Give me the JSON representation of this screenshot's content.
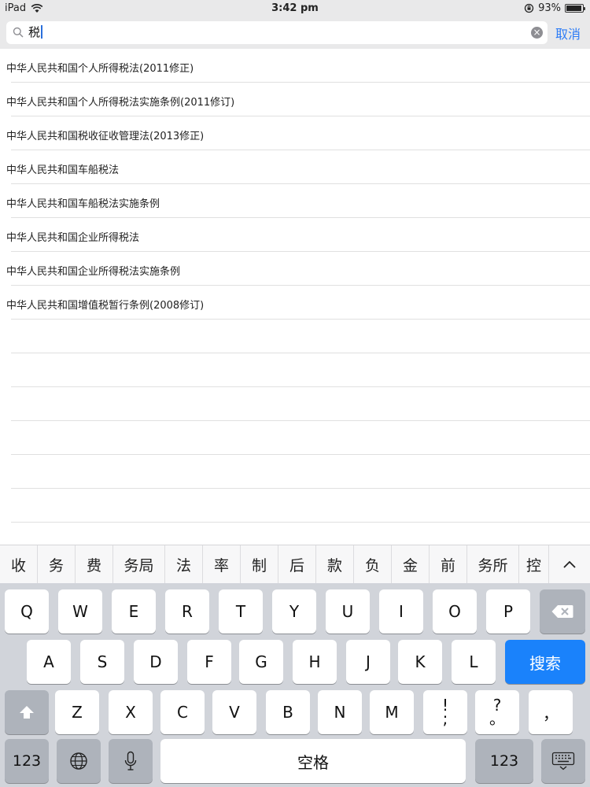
{
  "status": {
    "device": "iPad",
    "time": "3:42 pm",
    "battery": "93%",
    "battery_level": 0.93
  },
  "search": {
    "value": "税",
    "cancel_label": "取消"
  },
  "results": [
    "中华人民共和国个人所得税法(2011修正)",
    "中华人民共和国个人所得税法实施条例(2011修订)",
    "中华人民共和国税收征收管理法(2013修正)",
    "中华人民共和国车船税法",
    "中华人民共和国车船税法实施条例",
    "中华人民共和国企业所得税法",
    "中华人民共和国企业所得税法实施条例",
    "中华人民共和国增值税暂行条例(2008修订)"
  ],
  "candidates": [
    "收",
    "务",
    "费",
    "务局",
    "法",
    "率",
    "制",
    "后",
    "款",
    "负",
    "金",
    "前",
    "务所",
    "控"
  ],
  "keyboard": {
    "row1": [
      "Q",
      "W",
      "E",
      "R",
      "T",
      "Y",
      "U",
      "I",
      "O",
      "P"
    ],
    "row2": [
      "A",
      "S",
      "D",
      "F",
      "G",
      "H",
      "J",
      "K",
      "L"
    ],
    "row3": [
      "Z",
      "X",
      "C",
      "V",
      "B",
      "N",
      "M"
    ],
    "search_label": "搜索",
    "numbers_label": "123",
    "space_label": "空格",
    "exclaim_top": "!",
    "exclaim_bottom": ";",
    "question_top": "?",
    "question_bottom": "。",
    "comma": "，",
    "icons": [
      "backspace-icon",
      "shift-icon",
      "globe-icon",
      "microphone-icon",
      "keyboard-dismiss-icon"
    ]
  }
}
